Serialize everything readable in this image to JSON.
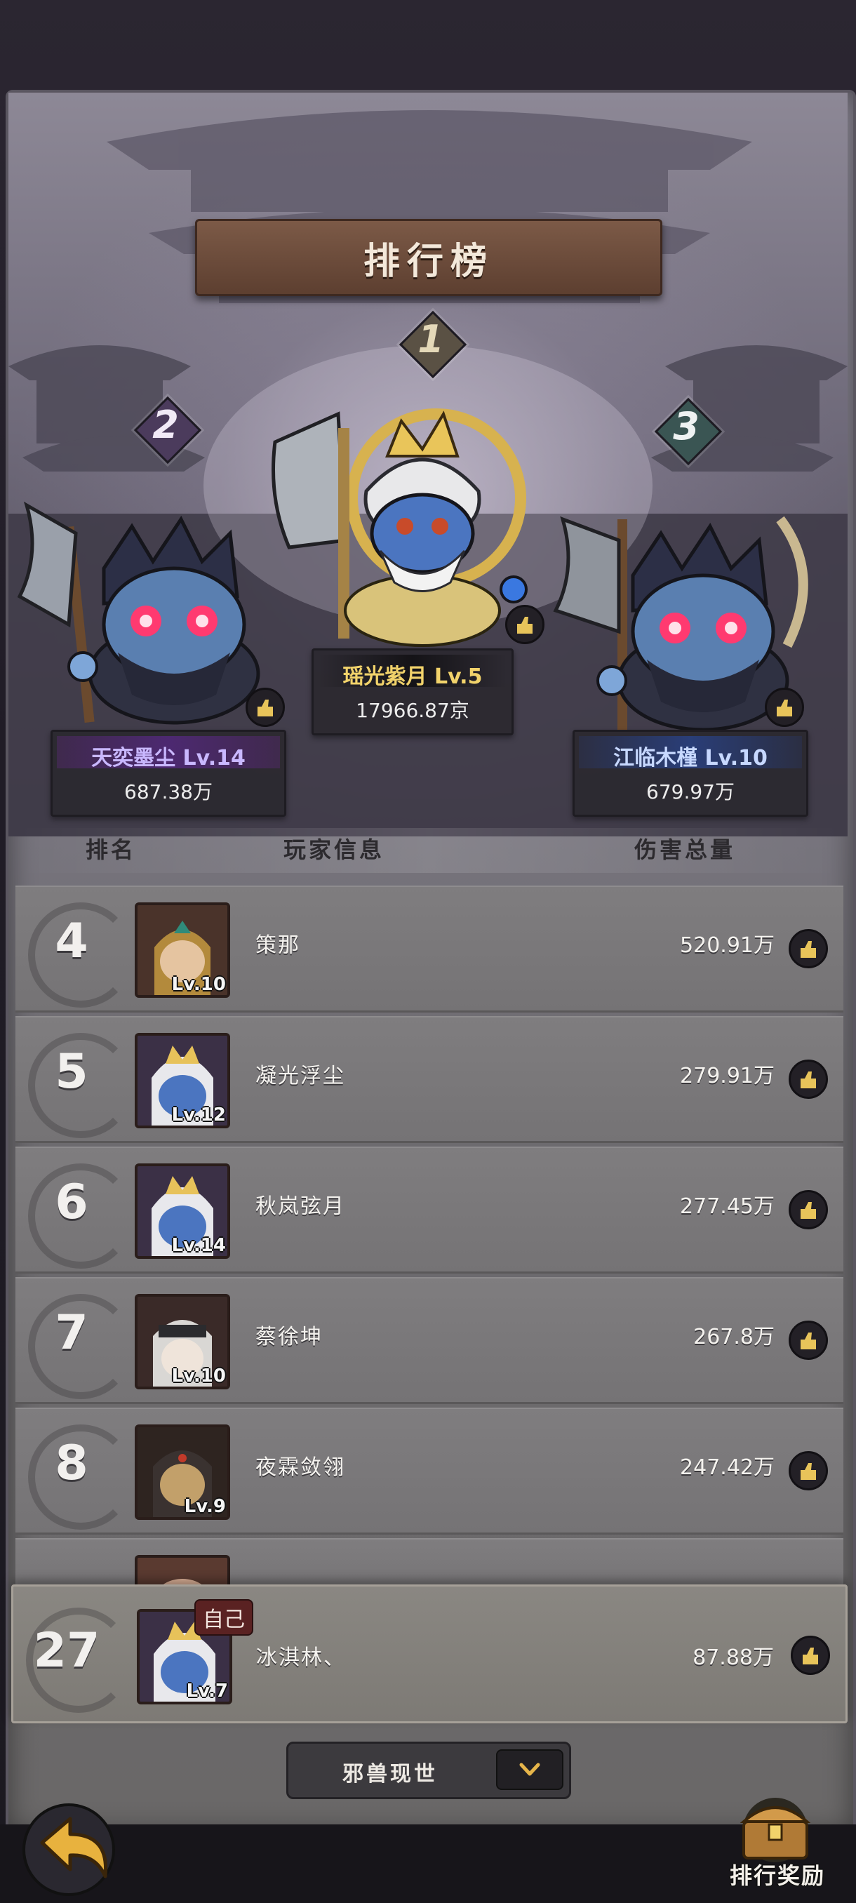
{
  "title": "排行榜",
  "podium": [
    {
      "rank": "1",
      "name": "瑶光紫月 Lv.5",
      "value": "17966.87京"
    },
    {
      "rank": "2",
      "name": "天奕墨尘 Lv.14",
      "value": "687.38万"
    },
    {
      "rank": "3",
      "name": "江临木槿 Lv.10",
      "value": "679.97万"
    }
  ],
  "columns": {
    "rank": "排名",
    "player": "玩家信息",
    "damage": "伤害总量"
  },
  "rows": [
    {
      "rank": "4",
      "level": "Lv.10",
      "name": "策那",
      "damage": "520.91万"
    },
    {
      "rank": "5",
      "level": "Lv.12",
      "name": "凝光浮尘",
      "damage": "279.91万"
    },
    {
      "rank": "6",
      "level": "Lv.14",
      "name": "秋岚弦月",
      "damage": "277.45万"
    },
    {
      "rank": "7",
      "level": "Lv.10",
      "name": "蔡徐坤",
      "damage": "267.8万"
    },
    {
      "rank": "8",
      "level": "Lv.9",
      "name": "夜霖敛翎",
      "damage": "247.42万"
    }
  ],
  "self": {
    "tag": "自己",
    "rank": "27",
    "level": "Lv.7",
    "name": "冰淇林、",
    "damage": "87.88万"
  },
  "dropdown": {
    "selected": "邪兽现世"
  },
  "reward_button": "排行奖励",
  "colors": {
    "rank1_name": "#f2d36b",
    "rank2_name": "#c9b8ff",
    "rank3_name": "#c7d8ff",
    "panel": "#7a7782"
  },
  "icons": [
    "like-icon",
    "back-arrow-icon",
    "treasure-chest-icon",
    "chevron-down-icon"
  ]
}
